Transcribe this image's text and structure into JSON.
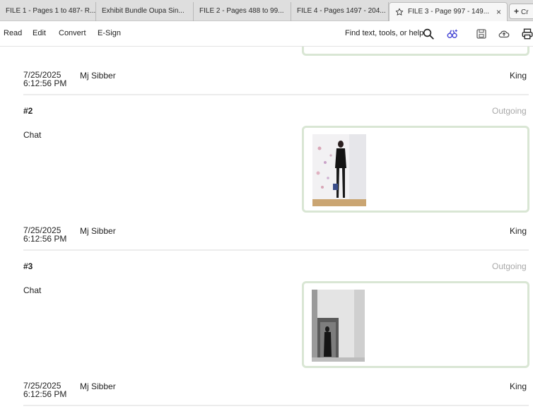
{
  "tabs": [
    {
      "label": "FILE 1 - Pages 1 to 487- R..."
    },
    {
      "label": "Exhibit Bundle Oupa Sin..."
    },
    {
      "label": "FILE 2 - Pages 488 to 99..."
    },
    {
      "label": "FILE 4 - Pages 1497 - 204..."
    },
    {
      "label": "FILE 3 - Page 997 - 149..."
    }
  ],
  "tab_close": "×",
  "new_tab": {
    "plus": "+",
    "label": "Cr"
  },
  "toolbar": {
    "menu": [
      "Read",
      "Edit",
      "Convert",
      "E-Sign"
    ],
    "find_label": "Find text, tools, or help"
  },
  "messages": [
    {
      "date": "7/25/2025",
      "time": "6:12:56 PM",
      "from": "Mj Sibber",
      "to": "King"
    },
    {
      "number": "#2",
      "direction": "Outgoing",
      "type": "Chat",
      "date": "7/25/2025",
      "time": "6:12:56 PM",
      "from": "Mj Sibber",
      "to": "King"
    },
    {
      "number": "#3",
      "direction": "Outgoing",
      "type": "Chat",
      "date": "7/25/2025",
      "time": "6:12:56 PM",
      "from": "Mj Sibber",
      "to": "King"
    }
  ]
}
